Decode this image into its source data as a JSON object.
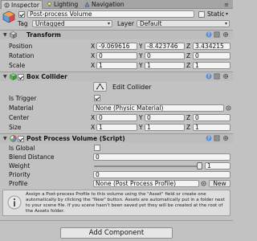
{
  "tabs": [
    {
      "label": "Inspector",
      "active": true
    },
    {
      "label": "Lighting",
      "active": false
    },
    {
      "label": "Navigation",
      "active": false
    }
  ],
  "header": {
    "name": "Post-process Volume",
    "static_label": "Static",
    "tag_label": "Tag",
    "tag_value": "Untagged",
    "layer_label": "Layer",
    "layer_value": "Default"
  },
  "transform": {
    "title": "Transform",
    "rows": [
      {
        "label": "Position",
        "x": "-9.069616",
        "y": "-8.423746",
        "z": "3.434215"
      },
      {
        "label": "Rotation",
        "x": "0",
        "y": "0",
        "z": "0"
      },
      {
        "label": "Scale",
        "x": "1",
        "y": "1",
        "z": "1"
      }
    ]
  },
  "box_collider": {
    "title": "Box Collider",
    "edit_label": "Edit Collider",
    "is_trigger_label": "Is Trigger",
    "material_label": "Material",
    "material_value": "None (Physic Material)",
    "center_label": "Center",
    "center": {
      "x": "0",
      "y": "0",
      "z": "0"
    },
    "size_label": "Size",
    "size": {
      "x": "1",
      "y": "1",
      "z": "1"
    }
  },
  "post_process": {
    "title": "Post Process Volume (Script)",
    "is_global_label": "Is Global",
    "blend_label": "Blend Distance",
    "blend_value": "0",
    "weight_label": "Weight",
    "weight_value": "1",
    "priority_label": "Priority",
    "priority_value": "0",
    "profile_label": "Profile",
    "profile_value": "None (Post Process Profile)",
    "new_label": "New",
    "help_text": "Assign a Post-process Profile to this volume using the \"Asset\" field or create one automatically by clicking the \"New\" button. Assets are automatically put in a folder next to your scene file. If you scene hasn't been saved yet they will be created at the root of the Assets folder."
  },
  "axis": {
    "x": "X",
    "y": "Y",
    "z": "Z"
  },
  "add_component_label": "Add Component",
  "icons": [
    "inspector-icon",
    "lighting-icon",
    "navigation-icon",
    "menu-icon",
    "cube-icon",
    "transform-icon",
    "box-collider-icon",
    "script-icon",
    "help-icon",
    "settings-icon",
    "edit-collider-icon",
    "info-icon",
    "object-picker-icon"
  ],
  "colors": {
    "background": "#c2c2c2",
    "header": "#bdbdbd",
    "field": "#f4f4f4"
  }
}
